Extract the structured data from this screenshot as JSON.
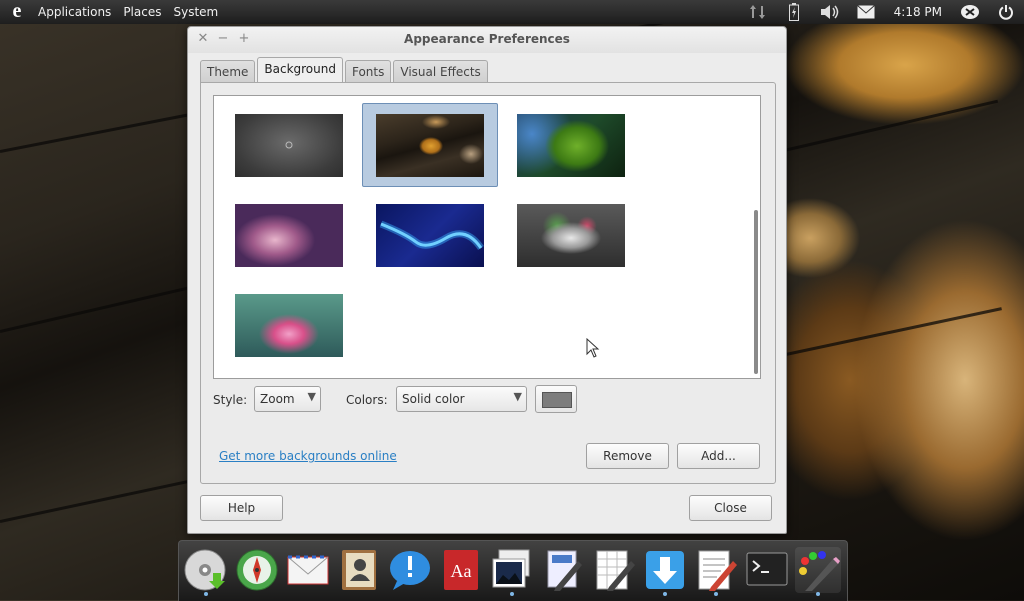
{
  "top_panel": {
    "menus": [
      "Applications",
      "Places",
      "System"
    ],
    "clock": "4:18 PM"
  },
  "window": {
    "title": "Appearance Preferences",
    "tabs": [
      {
        "label": "Theme",
        "active": false
      },
      {
        "label": "Background",
        "active": true
      },
      {
        "label": "Fonts",
        "active": false
      },
      {
        "label": "Visual Effects",
        "active": false
      }
    ],
    "background": {
      "style_label": "Style:",
      "style_value": "Zoom",
      "colors_label": "Colors:",
      "colors_value": "Solid color",
      "swatch_color": "#7d7d7d",
      "more_link": "Get more backgrounds online",
      "remove_label": "Remove",
      "add_label": "Add..."
    },
    "help_label": "Help",
    "close_label": "Close"
  }
}
